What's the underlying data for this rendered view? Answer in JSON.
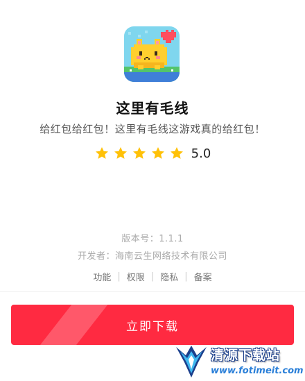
{
  "app": {
    "name": "这里有毛线",
    "description": "给红包给红包！这里有毛线这游戏真的给红包！",
    "rating": 5,
    "rating_text": "5.0"
  },
  "meta": {
    "version": "版本号：1.1.1",
    "developer": "开发者：海南云生网络技术有限公司"
  },
  "links": [
    "功能",
    "权限",
    "隐私",
    "备案"
  ],
  "download": {
    "label": "立即下载"
  },
  "watermark": {
    "title": "清源下载站",
    "url": "www.fotimeit.com"
  },
  "colors": {
    "accent": "#ff2a41",
    "star": "#ffc107",
    "icon_bg": "#7fd6ee",
    "cat": "#ffcf2e"
  },
  "icons": [
    "app-icon-pixel-cat",
    "star-icon",
    "watermark-logo-icon"
  ]
}
